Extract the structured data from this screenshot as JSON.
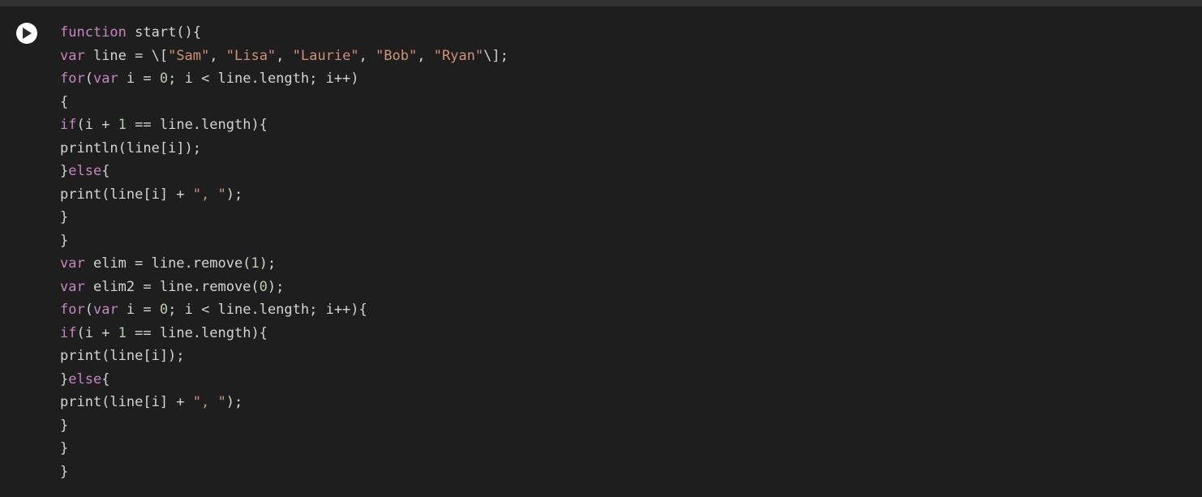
{
  "code": {
    "tokens": [
      [
        {
          "t": "function",
          "c": "kw"
        },
        {
          "t": " start(){",
          "c": "def"
        }
      ],
      [
        {
          "t": "var",
          "c": "kw"
        },
        {
          "t": " line = \\[",
          "c": "def"
        },
        {
          "t": "\"Sam\"",
          "c": "str"
        },
        {
          "t": ", ",
          "c": "def"
        },
        {
          "t": "\"Lisa\"",
          "c": "str"
        },
        {
          "t": ", ",
          "c": "def"
        },
        {
          "t": "\"Laurie\"",
          "c": "str"
        },
        {
          "t": ", ",
          "c": "def"
        },
        {
          "t": "\"Bob\"",
          "c": "str"
        },
        {
          "t": ", ",
          "c": "def"
        },
        {
          "t": "\"Ryan\"",
          "c": "str"
        },
        {
          "t": "\\];",
          "c": "def"
        }
      ],
      [
        {
          "t": "for",
          "c": "kw"
        },
        {
          "t": "(",
          "c": "def"
        },
        {
          "t": "var",
          "c": "kw"
        },
        {
          "t": " i = ",
          "c": "def"
        },
        {
          "t": "0",
          "c": "num"
        },
        {
          "t": "; i < line.length; i++)",
          "c": "def"
        }
      ],
      [
        {
          "t": "{",
          "c": "def"
        }
      ],
      [
        {
          "t": "if",
          "c": "kw"
        },
        {
          "t": "(i + ",
          "c": "def"
        },
        {
          "t": "1",
          "c": "num"
        },
        {
          "t": " == line.length){",
          "c": "def"
        }
      ],
      [
        {
          "t": "println(line[i]);",
          "c": "def"
        }
      ],
      [
        {
          "t": "}",
          "c": "def"
        },
        {
          "t": "else",
          "c": "kw"
        },
        {
          "t": "{",
          "c": "def"
        }
      ],
      [
        {
          "t": "print(line[i] + ",
          "c": "def"
        },
        {
          "t": "\", \"",
          "c": "str"
        },
        {
          "t": ");",
          "c": "def"
        }
      ],
      [
        {
          "t": "}",
          "c": "def"
        }
      ],
      [
        {
          "t": "}",
          "c": "def"
        }
      ],
      [
        {
          "t": "var",
          "c": "kw"
        },
        {
          "t": " elim = line.remove(",
          "c": "def"
        },
        {
          "t": "1",
          "c": "num"
        },
        {
          "t": ");",
          "c": "def"
        }
      ],
      [
        {
          "t": "var",
          "c": "kw"
        },
        {
          "t": " elim2 = line.remove(",
          "c": "def"
        },
        {
          "t": "0",
          "c": "num"
        },
        {
          "t": ");",
          "c": "def"
        }
      ],
      [
        {
          "t": "for",
          "c": "kw"
        },
        {
          "t": "(",
          "c": "def"
        },
        {
          "t": "var",
          "c": "kw"
        },
        {
          "t": " i = ",
          "c": "def"
        },
        {
          "t": "0",
          "c": "num"
        },
        {
          "t": "; i < line.length; i++){",
          "c": "def"
        }
      ],
      [
        {
          "t": "if",
          "c": "kw"
        },
        {
          "t": "(i + ",
          "c": "def"
        },
        {
          "t": "1",
          "c": "num"
        },
        {
          "t": " == line.length){",
          "c": "def"
        }
      ],
      [
        {
          "t": "print(line[i]);",
          "c": "def"
        }
      ],
      [
        {
          "t": "}",
          "c": "def"
        },
        {
          "t": "else",
          "c": "kw"
        },
        {
          "t": "{",
          "c": "def"
        }
      ],
      [
        {
          "t": "print(line[i] + ",
          "c": "def"
        },
        {
          "t": "\", \"",
          "c": "str"
        },
        {
          "t": ");",
          "c": "def"
        }
      ],
      [
        {
          "t": "}",
          "c": "def"
        }
      ],
      [
        {
          "t": "}",
          "c": "def"
        }
      ],
      [
        {
          "t": "}",
          "c": "def"
        }
      ]
    ]
  },
  "runButton": {
    "label": "Run"
  }
}
